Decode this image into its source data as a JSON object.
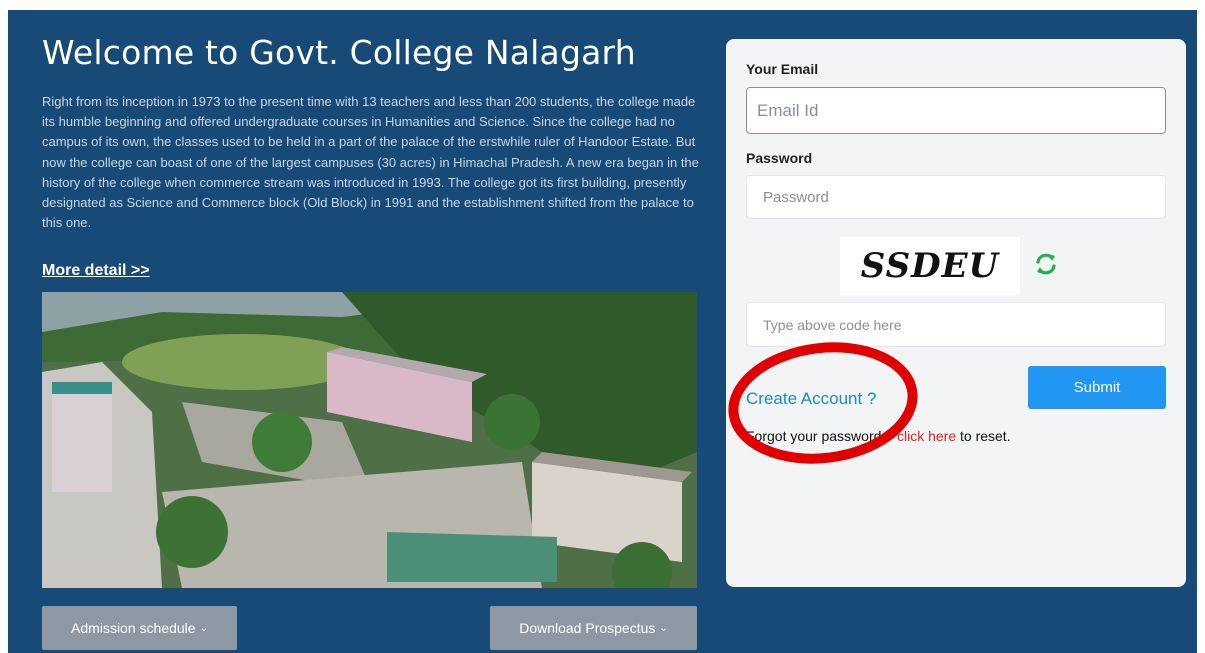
{
  "hero": {
    "title": "Welcome to Govt. College Nalagarh",
    "intro": "Right from its inception in 1973 to the present time with 13 teachers and less than 200 students, the college made its humble beginning and offered undergraduate courses in Humanities and Science. Since the college had no campus of its own, the classes used to be held in a part of the palace of the erstwhile ruler of Handoor Estate. But now the college can boast of one of the largest campuses (30 acres) in Himachal Pradesh. A new era began in the history of the college when commerce stream was introduced in 1993. The college got its first building, presently designated as Science and Commerce block (Old Block) in 1991 and the establishment shifted from the palace to this one.",
    "more_link": "More detail >>"
  },
  "buttons": {
    "admission": "Admission schedule",
    "prospectus": "Download Prospectus",
    "caret": "⌄"
  },
  "login": {
    "email_label": "Your Email",
    "email_placeholder": "Email Id",
    "password_label": "Password",
    "password_placeholder": "Password",
    "captcha_text": "SSDEU",
    "code_placeholder": "Type above code here",
    "create_account": "Create Account ?",
    "submit": "Submit",
    "forgot_prefix": "Forgot your password ? ",
    "forgot_link": "click here",
    "forgot_suffix": " to reset."
  },
  "colors": {
    "panel": "#184a78",
    "accent": "#2196f3",
    "link": "#1e88c9",
    "reset_link": "#e02020",
    "annotation": "#e00000"
  },
  "icons": {
    "refresh": "refresh-icon"
  }
}
